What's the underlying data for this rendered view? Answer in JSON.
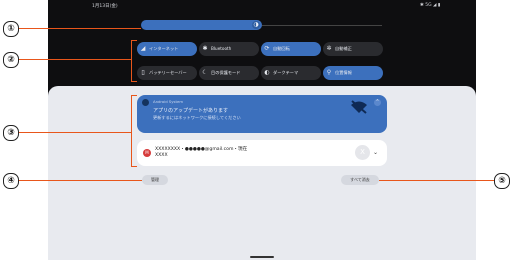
{
  "status_bar": {
    "time": "1月13日(金)",
    "icons": "✱ 5G ◢ ▮"
  },
  "quick_settings": {
    "tiles": [
      {
        "label": "インターネット",
        "icon": "◢",
        "state": "on"
      },
      {
        "label": "Bluetooth",
        "icon": "✱",
        "state": "off"
      },
      {
        "label": "自動回転",
        "icon": "⟳",
        "state": "on"
      },
      {
        "label": "自動補正",
        "icon": "✲",
        "state": "off"
      },
      {
        "label": "バッテリーセーバー",
        "icon": "▯",
        "state": "off"
      },
      {
        "label": "目の保護モード",
        "icon": "☾",
        "state": "off"
      },
      {
        "label": "ダークテーマ",
        "icon": "◐",
        "state": "off"
      },
      {
        "label": "位置情報",
        "icon": "⚲",
        "state": "on"
      }
    ]
  },
  "notifications": {
    "update": {
      "app": "Android System",
      "title": "アプリのアップデートがあります",
      "text": "更新するにはネットワークに接続してください"
    },
    "mail": {
      "sender": "XXXXXXXX・●●●●●@gmail.com・現在",
      "text": "XXXX",
      "avatar": "X"
    }
  },
  "buttons": {
    "manage": "管理",
    "clear_all": "すべて消去"
  },
  "callouts": [
    "①",
    "②",
    "③",
    "④",
    "⑤"
  ],
  "colors": {
    "accent": "#3c70bd",
    "callout_line": "#e8561b"
  }
}
